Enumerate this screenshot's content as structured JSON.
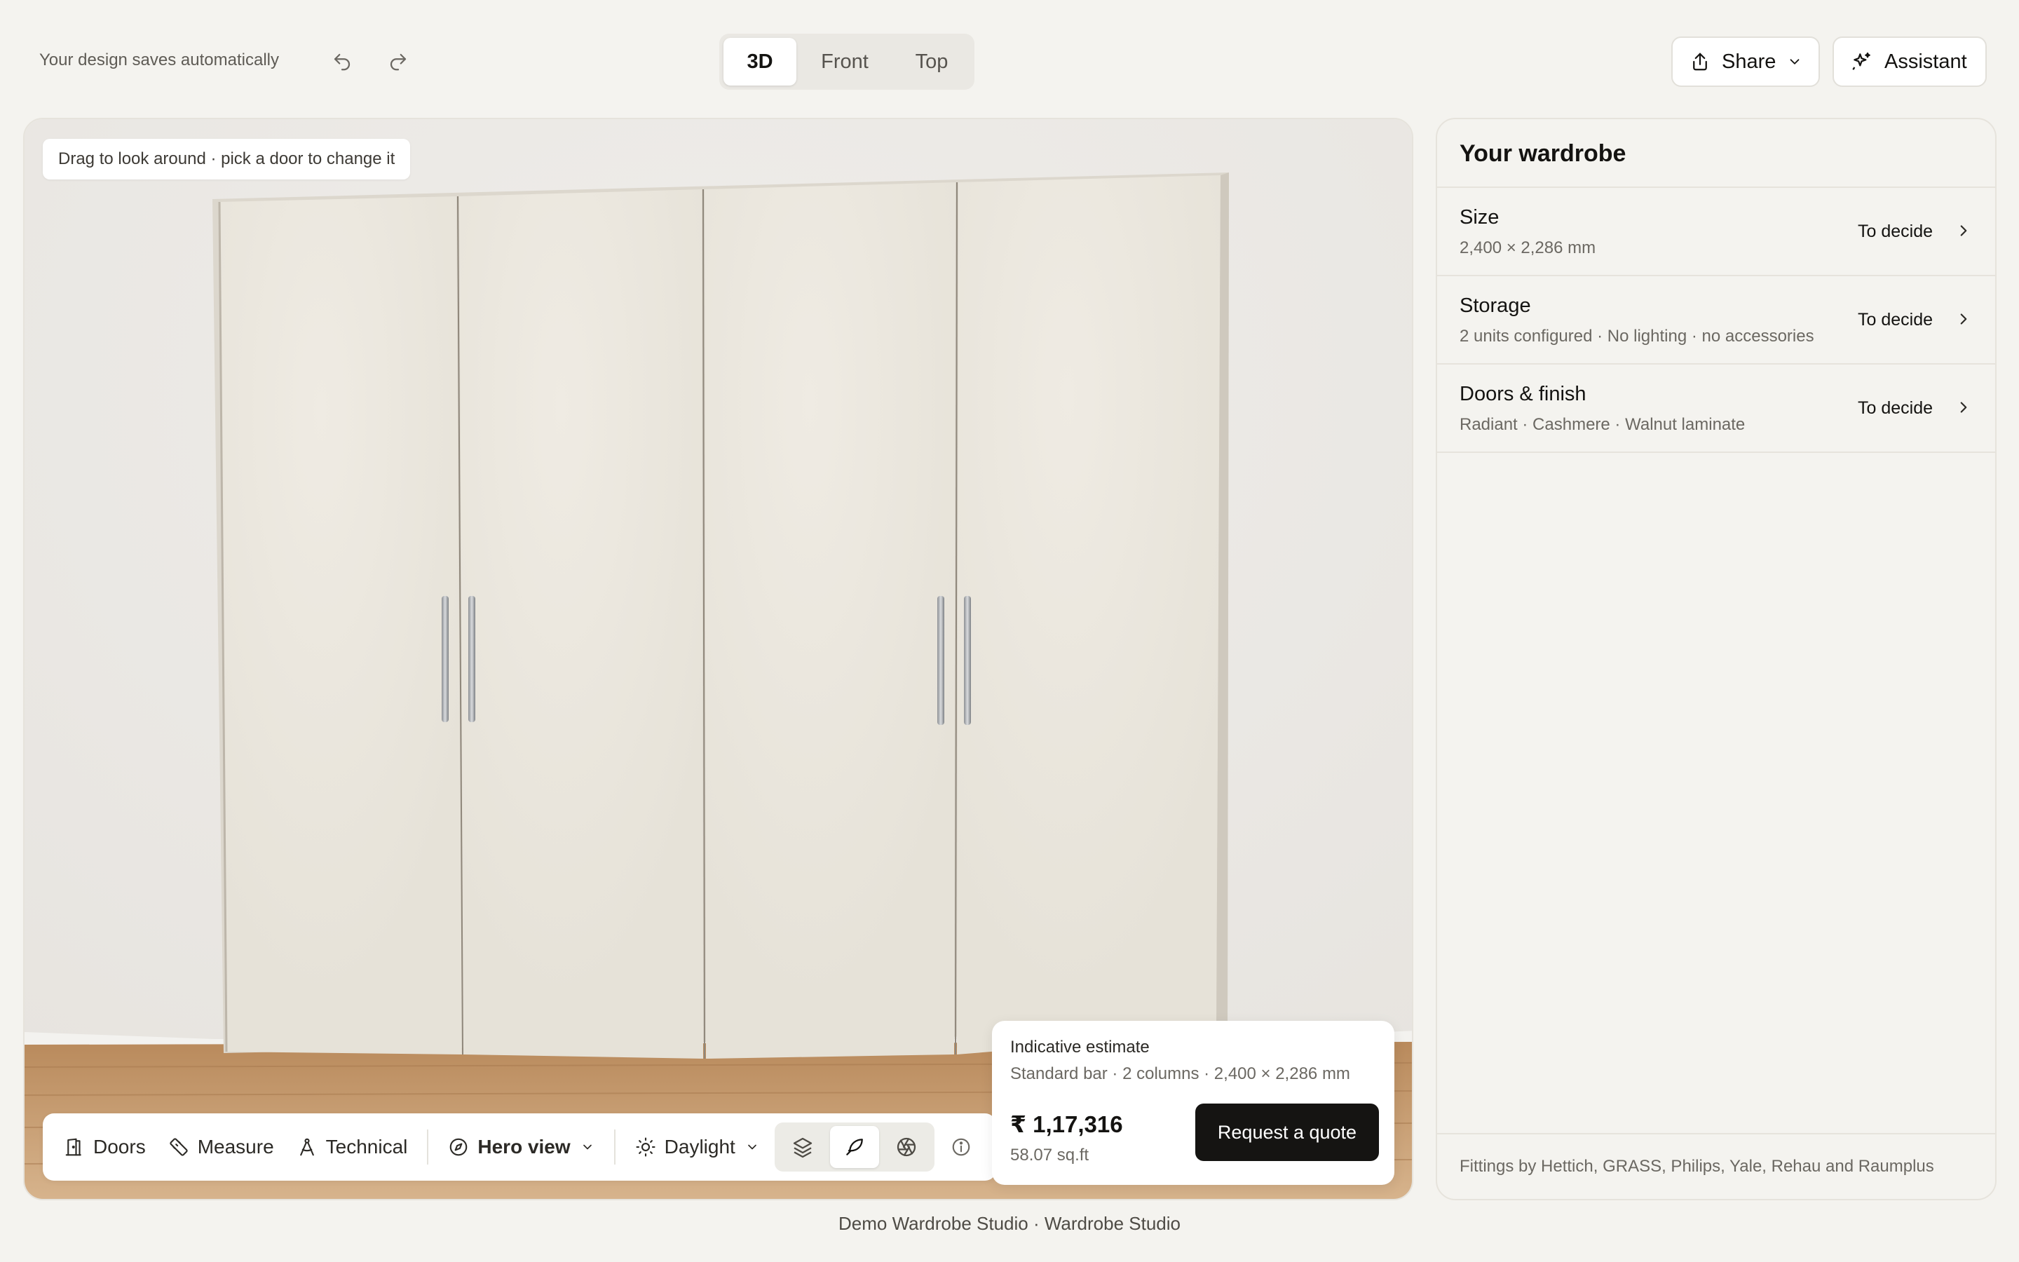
{
  "header": {
    "autosave": "Your design saves automatically",
    "view_tabs": [
      "3D",
      "Front",
      "Top"
    ],
    "active_view": "3D",
    "share_label": "Share",
    "assistant_label": "Assistant"
  },
  "viewport": {
    "hint": "Drag to look around · pick a door to change it",
    "toolbar": {
      "doors": "Doors",
      "measure": "Measure",
      "technical": "Technical",
      "camera": "Hero view",
      "lighting": "Daylight"
    }
  },
  "estimate": {
    "title": "Indicative estimate",
    "subtitle": "Standard bar · 2 columns · 2,400 × 2,286 mm",
    "price": "₹ 1,17,316",
    "area": "58.07 sq.ft",
    "cta": "Request a quote"
  },
  "panel": {
    "title": "Your wardrobe",
    "rows": [
      {
        "name": "Size",
        "detail": "2,400 × 2,286 mm",
        "status": "To decide"
      },
      {
        "name": "Storage",
        "detail": "2 units configured · No lighting · no accessories",
        "status": "To decide"
      },
      {
        "name": "Doors & finish",
        "detail": "Radiant · Cashmere · Walnut laminate",
        "status": "To decide"
      }
    ],
    "fittings": "Fittings by Hettich, GRASS, Philips, Yale, Rehau and Raumplus"
  },
  "footer": "Demo Wardrobe Studio · Wardrobe Studio",
  "colors": {
    "background": "#f4f3ef",
    "accent_button": "#151412",
    "door_panel": "#e9e5dc",
    "floor": "#c79a6c"
  }
}
